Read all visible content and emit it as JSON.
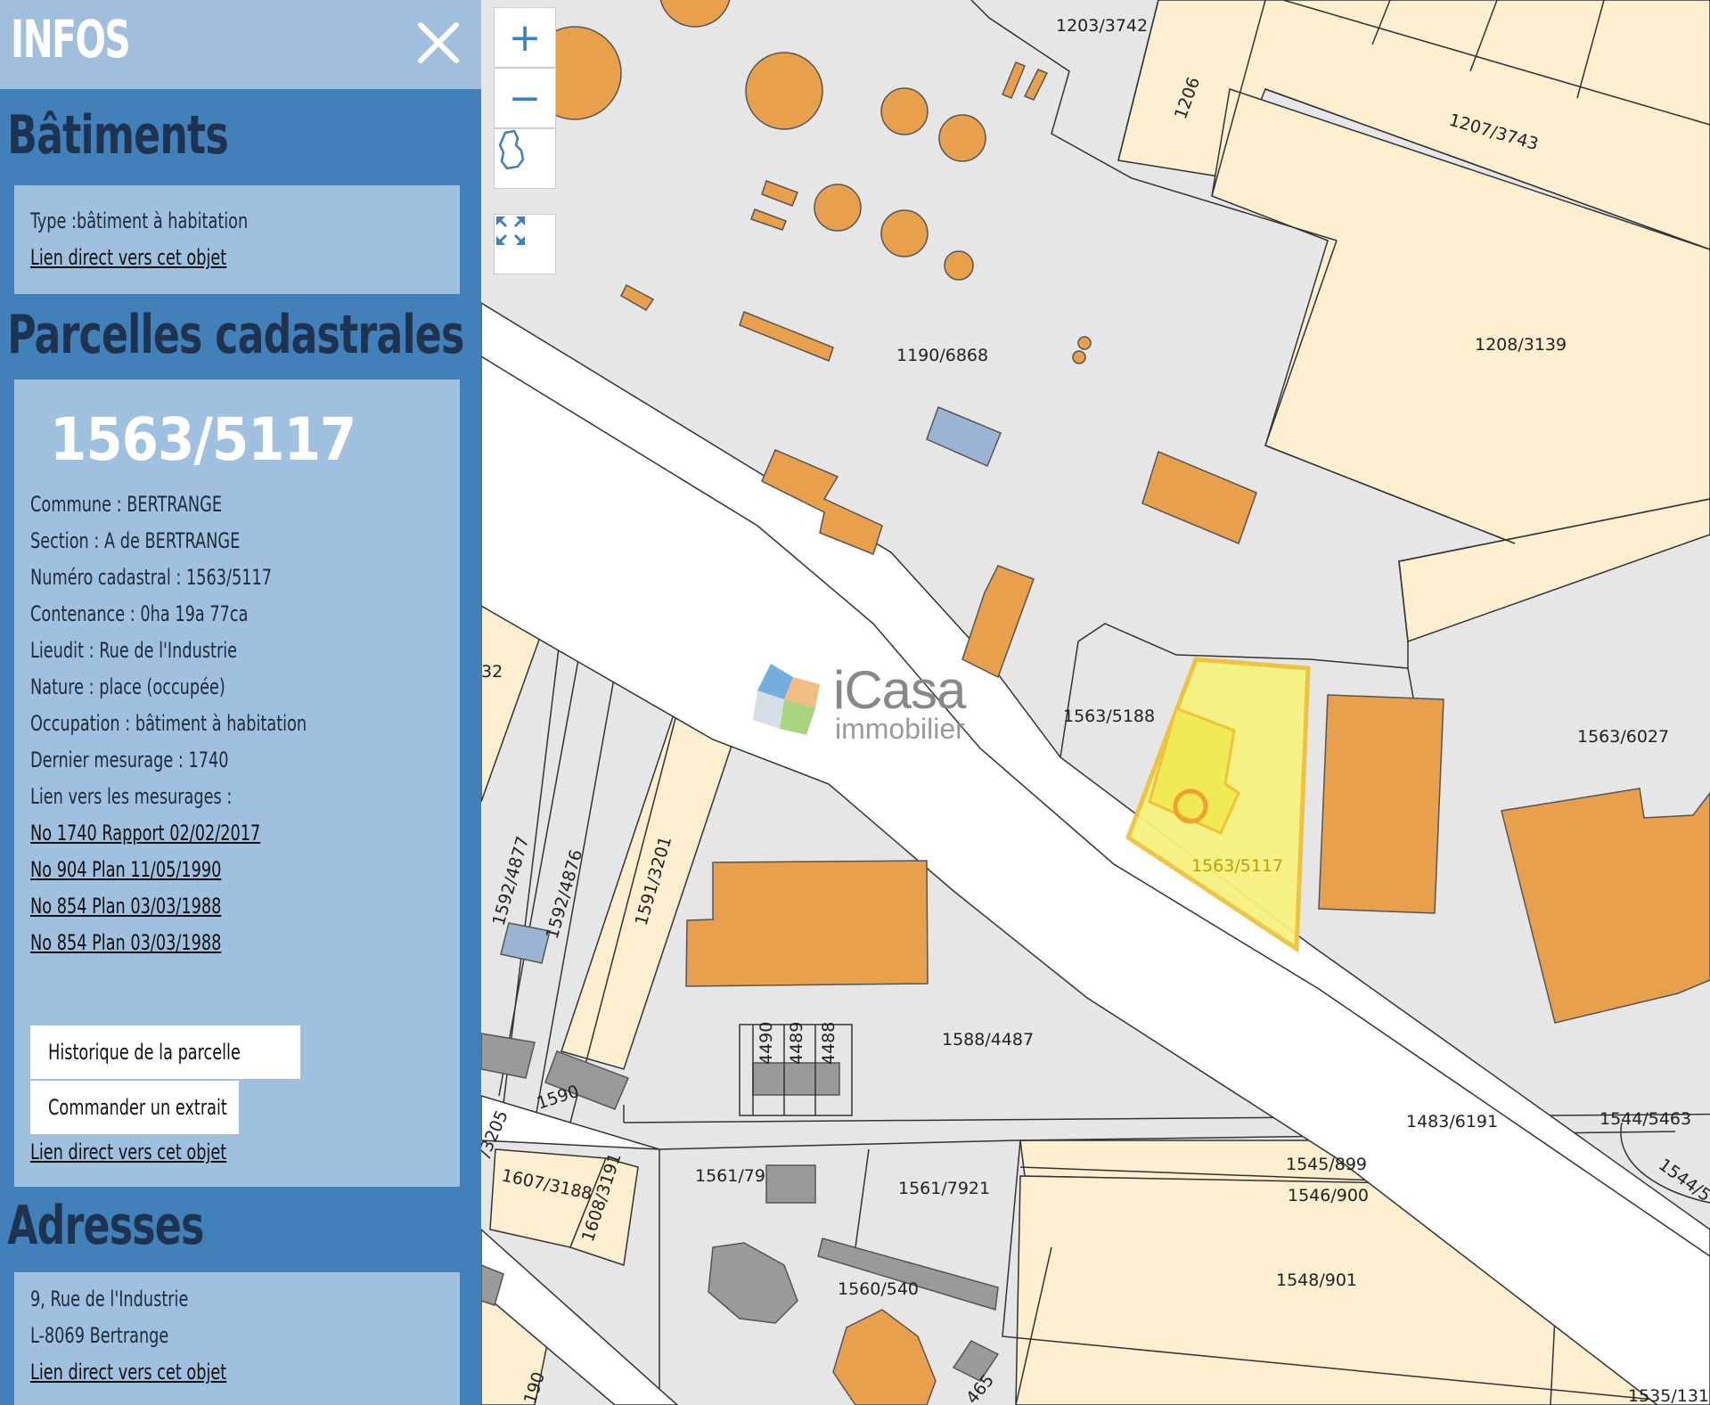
{
  "panel": {
    "title": "INFOS",
    "buildings": {
      "heading": "Bâtiments",
      "type": "Type :bâtiment à habitation",
      "link": "Lien direct vers cet objet"
    },
    "parcels": {
      "heading": "Parcelles cadastrales",
      "number": "1563/5117",
      "commune": "Commune : BERTRANGE",
      "section": "Section : A de BERTRANGE",
      "numero": "Numéro cadastral : 1563/5117",
      "contenance": "Contenance : 0ha 19a 77ca",
      "lieudit": "Lieudit : Rue de l'Industrie",
      "nature": "Nature : place (occupée)",
      "occupation": "Occupation : bâtiment à habitation",
      "dernier": "Dernier mesurage : 1740",
      "mesurages_label": "Lien vers les mesurages :",
      "mesurages": [
        "No 1740 Rapport 02/02/2017",
        "No 904 Plan 11/05/1990",
        "No 854 Plan 03/03/1988",
        "No 854 Plan 03/03/1988"
      ],
      "history_button": "Historique de la parcelle",
      "order_button": "Commander un extrait",
      "link": "Lien direct vers cet objet"
    },
    "addresses": {
      "heading": "Adresses",
      "street": "9, Rue de l'Industrie",
      "city": "L-8069 Bertrange",
      "link": "Lien direct vers cet objet"
    }
  },
  "map_controls": {
    "zoom_in": "+",
    "zoom_out": "−"
  },
  "watermark": {
    "brand": "iCasa",
    "sub": "immobilier"
  },
  "map_labels": [
    "1203/3742",
    "1206",
    "1207/3743",
    "1190/6868",
    "1208/3139",
    "1563/5188",
    "1563/5117",
    "1563/6027",
    "32",
    "1592/4877",
    "1592/4876",
    "1591/3201",
    "4490",
    "4489",
    "4488",
    "1588/4487",
    "1483/6191",
    "1544/5463",
    "1544/5",
    "1545/899",
    "1546/900",
    "1548/901",
    "1561/79",
    "1561/7921",
    "1560/540",
    "1607/3188",
    "1608/3191",
    "/3205",
    "1590",
    "1535/131",
    "190",
    "465"
  ],
  "colors": {
    "sidebar": "#4180b9",
    "card": "#9fc0de",
    "building": "#e8a04c",
    "parcel": "#fdefcf",
    "selected": "#f4f07a",
    "road": "#ffffff"
  }
}
